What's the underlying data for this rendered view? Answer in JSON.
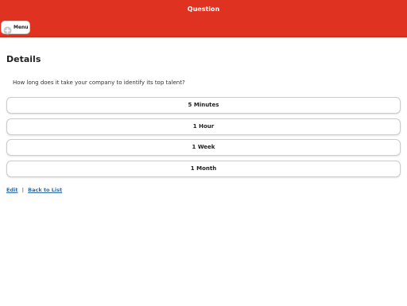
{
  "header": {
    "title": "Question",
    "menu_label": "Menu",
    "menu_icon": "plus-circle-icon",
    "background": "#e03220"
  },
  "page": {
    "title": "Details",
    "question": "How long does it take your company to identify its top talent?"
  },
  "answers": [
    {
      "label": "5 Minutes"
    },
    {
      "label": "1 Hour"
    },
    {
      "label": "1 Week"
    },
    {
      "label": "1 Month"
    }
  ],
  "links": {
    "edit": "Edit",
    "separator": "|",
    "back": "Back to List",
    "color": "#2f6aa8"
  }
}
